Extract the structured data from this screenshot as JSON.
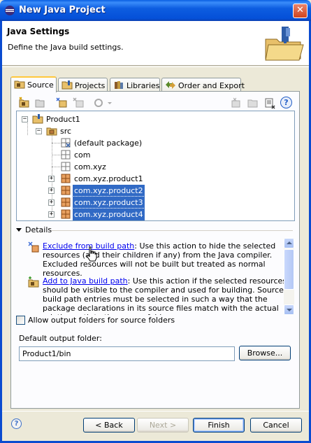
{
  "window": {
    "title": "New Java Project",
    "close_glyph": "✕"
  },
  "banner": {
    "title": "Java Settings",
    "description": "Define the Java build settings."
  },
  "tabs": [
    {
      "label": "Source",
      "icon": "source-folder-icon",
      "active": true
    },
    {
      "label": "Projects",
      "icon": "projects-icon",
      "active": false
    },
    {
      "label": "Libraries",
      "icon": "libraries-icon",
      "active": false
    },
    {
      "label": "Order and Export",
      "icon": "order-export-icon",
      "active": false
    }
  ],
  "toolbar": {
    "help_glyph": "?"
  },
  "tree": [
    {
      "label": "Product1",
      "icon": "java-project-icon",
      "expander": "−",
      "selected": false
    },
    {
      "label": "src",
      "icon": "source-folder-icon",
      "expander": "−",
      "selected": false
    },
    {
      "label": "(default package)",
      "icon": "package-icon",
      "expander": "",
      "selected": false
    },
    {
      "label": "com",
      "icon": "package-icon",
      "expander": "",
      "selected": false
    },
    {
      "label": "com.xyz",
      "icon": "package-icon",
      "expander": "",
      "selected": false
    },
    {
      "label": "com.xyz.product1",
      "icon": "package-icon",
      "expander": "+",
      "selected": false
    },
    {
      "label": "com.xyz.product2",
      "icon": "package-icon",
      "expander": "+",
      "selected": true
    },
    {
      "label": "com.xyz.product3",
      "icon": "package-icon",
      "expander": "+",
      "selected": true
    },
    {
      "label": "com.xyz.product4",
      "icon": "package-icon",
      "expander": "+",
      "selected": true
    }
  ],
  "details": {
    "header": "Details",
    "actions": [
      {
        "link": "Exclude from build path",
        "text": ": Use this action to hide the selected resources (and their children if any) from the Java compiler. Excluded resources will not be built but treated as normal resources."
      },
      {
        "link": "Add to Java build path",
        "text": ": Use this action if the selected resources should be visible to the compiler and used for building. Source build path entries must be selected in such a way that the package declarations in its source files match with the actual relative path to the source folder."
      }
    ]
  },
  "allow_output_folders": {
    "label": "Allow output folders for source folders",
    "checked": false
  },
  "output_folder": {
    "label": "Default output folder:",
    "value": "Product1/bin",
    "browse_label": "Browse..."
  },
  "footer": {
    "help_glyph": "?",
    "back_label": "< Back",
    "next_label": "Next >",
    "finish_label": "Finish",
    "cancel_label": "Cancel",
    "next_enabled": false
  },
  "colors": {
    "selection": "#316ac5",
    "link": "#0000ee",
    "titlebar": "#0550d8"
  }
}
